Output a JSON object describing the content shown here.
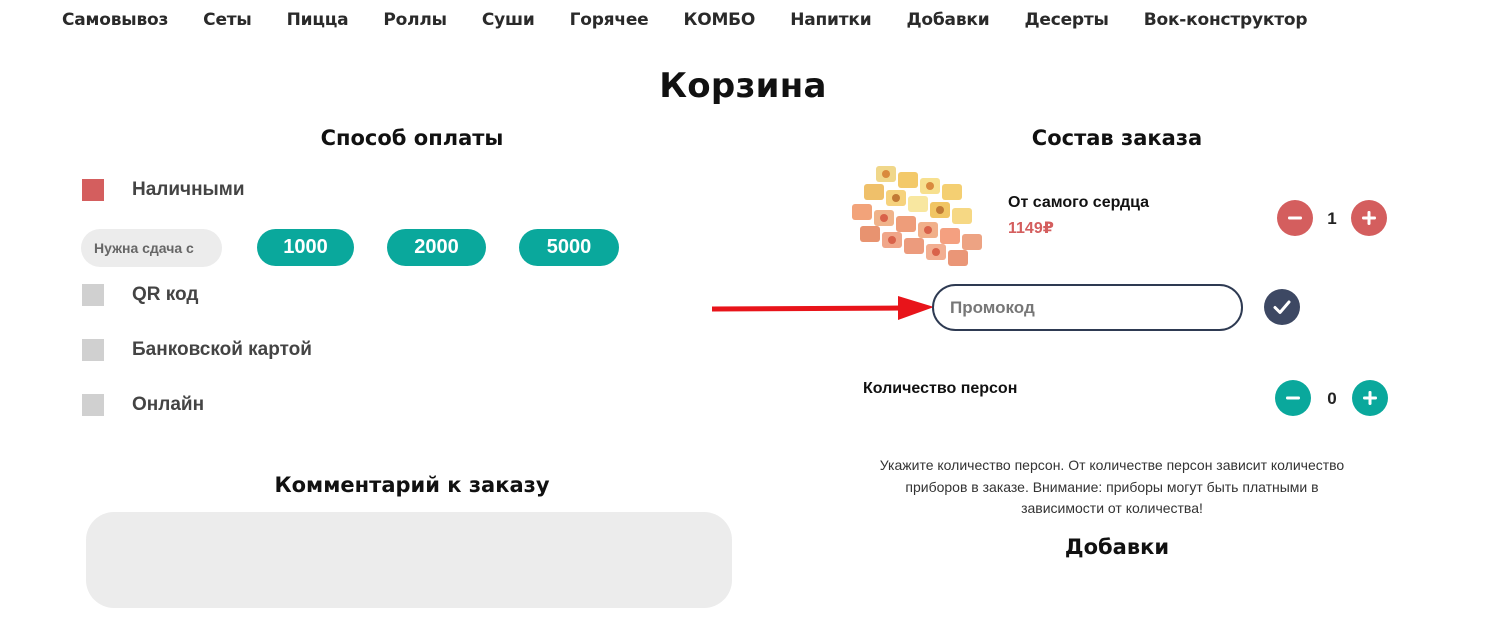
{
  "nav": [
    "Самовывоз",
    "Сеты",
    "Пицца",
    "Роллы",
    "Суши",
    "Горячее",
    "КОМБО",
    "Напитки",
    "Добавки",
    "Десерты",
    "Вок-конструктор"
  ],
  "page_title": "Корзина",
  "payment": {
    "title": "Способ оплаты",
    "options": [
      {
        "label": "Наличными",
        "checked": true
      },
      {
        "label": "QR код",
        "checked": false
      },
      {
        "label": "Банковской картой",
        "checked": false
      },
      {
        "label": "Онлайн",
        "checked": false
      }
    ],
    "change_placeholder": "Нужна сдача с",
    "change_options": [
      "1000",
      "2000",
      "5000"
    ]
  },
  "comment": {
    "title": "Комментарий к заказу",
    "value": ""
  },
  "order": {
    "title": "Состав заказа",
    "items": [
      {
        "name": "От самого сердца",
        "price": "1149₽",
        "qty": "1"
      }
    ],
    "promo_placeholder": "Промокод",
    "persons_label": "Количество персон",
    "persons_qty": "0",
    "persons_note": "Укажите количество персон. От количестве персон зависит количество приборов в заказе. Внимание: приборы могут быть платными в зависимости от количества!"
  },
  "addons": {
    "title": "Добавки"
  },
  "colors": {
    "accent_green": "#0aa89c",
    "accent_red": "#d45e5e",
    "promo_dark": "#3d4863",
    "arrow_red": "#e8141a"
  }
}
